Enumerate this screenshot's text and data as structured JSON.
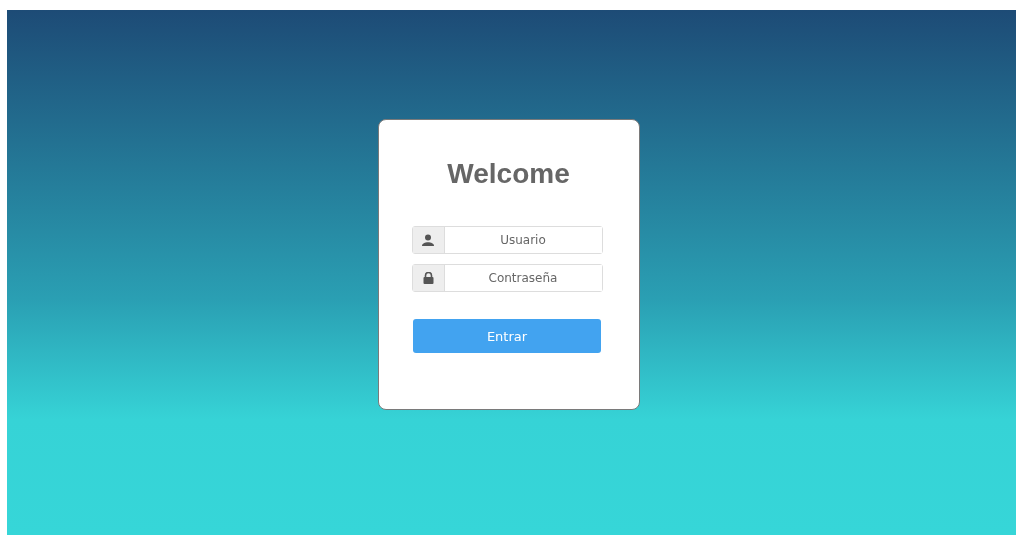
{
  "login": {
    "title": "Welcome",
    "fields": [
      {
        "kind": "user",
        "placeholder": "Usuario"
      },
      {
        "kind": "lock",
        "placeholder": "Contraseña"
      }
    ],
    "button": "Entrar"
  }
}
